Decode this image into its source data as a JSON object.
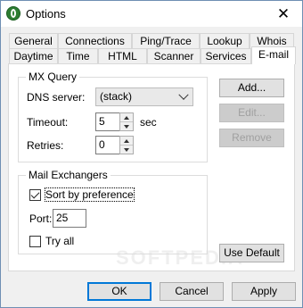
{
  "window": {
    "title": "Options",
    "close_glyph": "✕"
  },
  "tabs": {
    "row1": [
      "General",
      "Connections",
      "Ping/Trace",
      "Lookup",
      "Whois"
    ],
    "row2": [
      "Daytime",
      "Time",
      "HTML",
      "Scanner",
      "Services",
      "E-mail"
    ],
    "active": "E-mail"
  },
  "mx_query": {
    "group_label": "MX Query",
    "dns_server_label": "DNS server:",
    "dns_server_value": "(stack)",
    "timeout_label": "Timeout:",
    "timeout_value": "5",
    "timeout_unit": "sec",
    "retries_label": "Retries:",
    "retries_value": "0"
  },
  "mail_exchangers": {
    "group_label": "Mail Exchangers",
    "sort_label": "Sort by preference",
    "sort_checked": true,
    "port_label": "Port:",
    "port_value": "25",
    "try_all_label": "Try all",
    "try_all_checked": false
  },
  "side_buttons": {
    "add": "Add...",
    "edit": "Edit...",
    "remove": "Remove",
    "use_default": "Use Default"
  },
  "footer": {
    "ok": "OK",
    "cancel": "Cancel",
    "apply": "Apply"
  },
  "watermark": "SOFTPEDIA"
}
